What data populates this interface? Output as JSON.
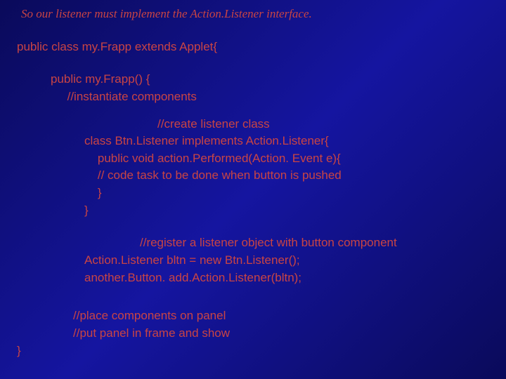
{
  "intro": "So our listener must implement the Action.Listener interface.",
  "lines": {
    "l1": "public class my.Frapp extends Applet{",
    "l2": "public my.Frapp() {",
    "l3": "     //instantiate components",
    "l4": "//create listener class",
    "l5": "class Btn.Listener implements Action.Listener{",
    "l6": "    public void action.Performed(Action. Event e){",
    "l7": "    // code task to be done when button is pushed",
    "l8": "    }",
    "l9": "}",
    "l10": "//register a listener object with button component",
    "l11": "Action.Listener bltn = new Btn.Listener();",
    "l12": "another.Button. add.Action.Listener(bltn);",
    "l13": "//place components on panel",
    "l14": "//put panel in frame and show",
    "l15": "}"
  }
}
